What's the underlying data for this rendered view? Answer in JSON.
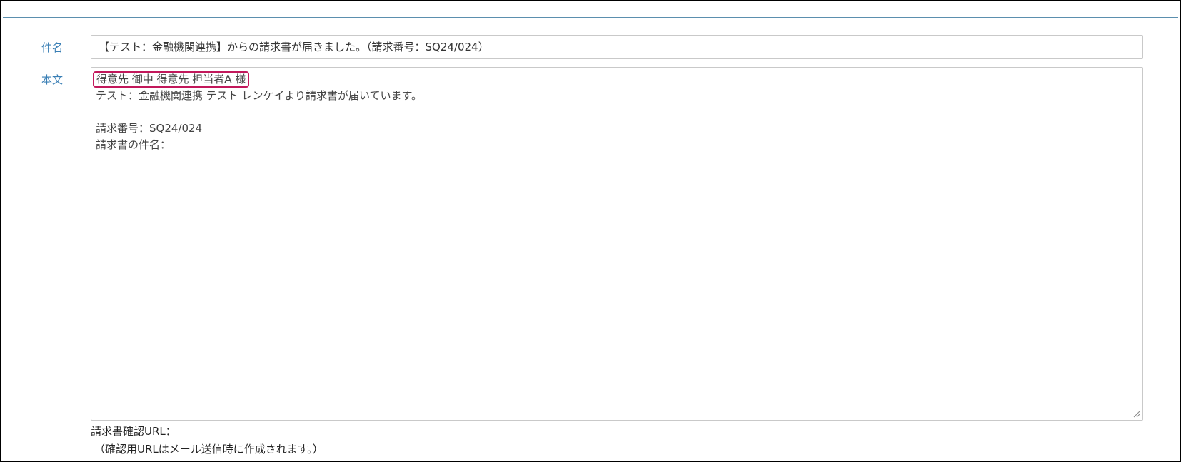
{
  "form": {
    "subject_label": "件名",
    "subject_value": "【テスト：金融機関連携】からの請求書が届きました。（請求番号：SQ24/024）",
    "body_label": "本文",
    "body_lines": [
      "得意先 御中 得意先 担当者A 様",
      "テスト：金融機関連携 テスト レンケイより請求書が届いています。",
      "",
      "請求番号：SQ24/024",
      "請求書の件名："
    ],
    "footer_lines": [
      "請求書確認URL：",
      "（確認用URLはメール送信時に作成されます。）"
    ]
  },
  "icons": {
    "resize": "resize-grip-icon"
  },
  "colors": {
    "label": "#3a7fb5",
    "highlight_border": "#c2185b",
    "top_rule": "#5b8fae"
  }
}
